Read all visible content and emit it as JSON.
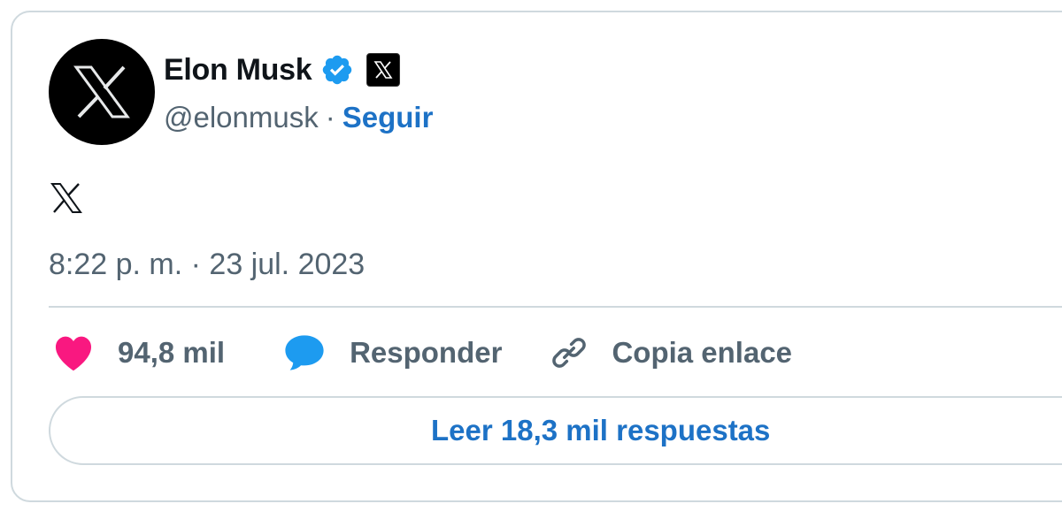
{
  "author": {
    "name": "Elon Musk",
    "handle": "@elonmusk",
    "separator": "·",
    "follow_label": "Seguir",
    "avatar_icon": "x-logo-icon",
    "verified_icon": "verified-badge-icon",
    "verified_color": "#1d9bf0",
    "affiliate_icon": "x-affiliate-badge-icon"
  },
  "tweet": {
    "text_icon": "x-logo-icon",
    "timestamp": "8:22 p. m. · 23 jul. 2023"
  },
  "actions": {
    "likes_count": "94,8 mil",
    "like_icon": "heart-icon",
    "like_color": "#f91880",
    "reply_label": "Responder",
    "reply_icon": "speech-bubble-icon",
    "reply_color": "#1d9bf0",
    "copy_label": "Copia enlace",
    "copy_icon": "link-icon"
  },
  "read_replies_label": "Leer 18,3 mil respuestas",
  "colors": {
    "link": "#1d72c6",
    "secondary_text": "#536471",
    "border": "#cfd9de"
  }
}
